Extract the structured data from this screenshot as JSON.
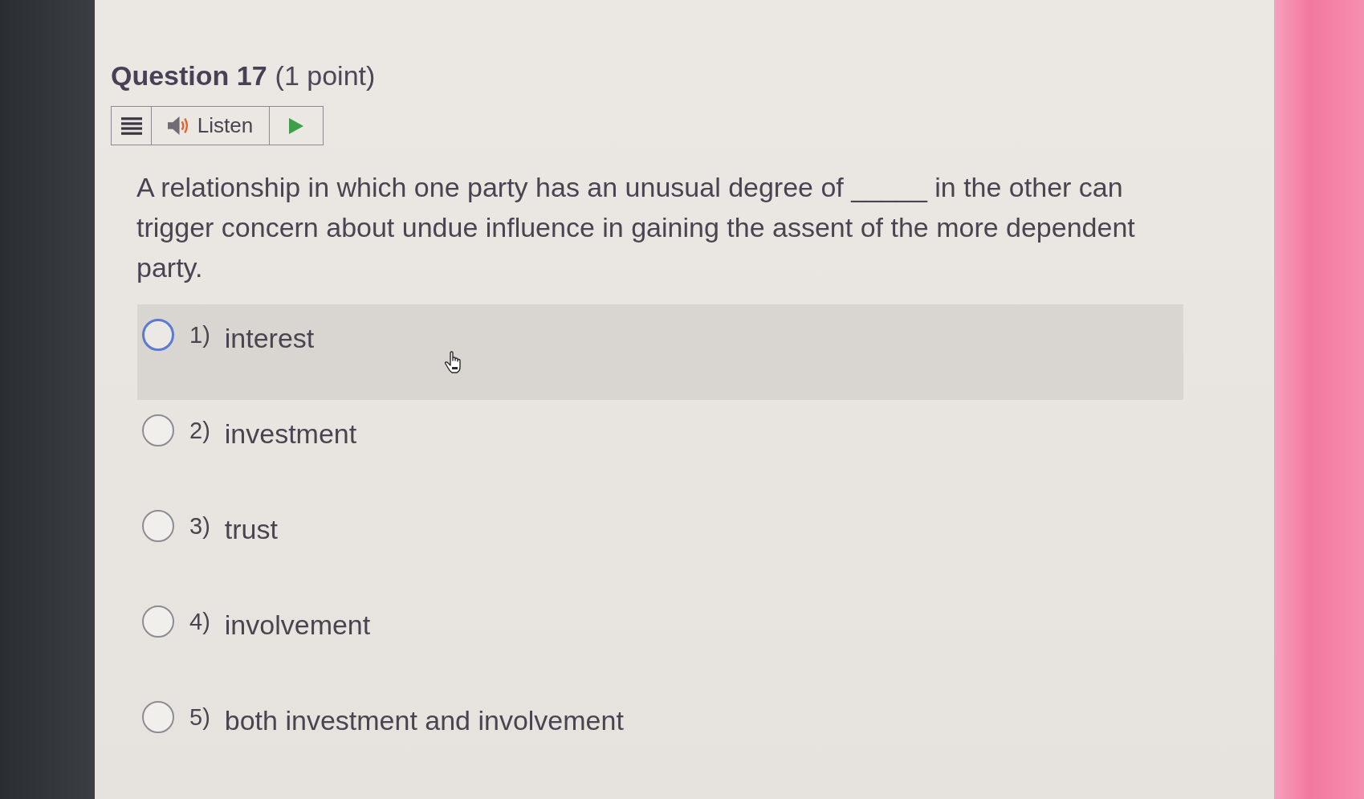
{
  "question": {
    "title": "Question 17",
    "points": "(1 point)"
  },
  "toolbar": {
    "listen_label": "Listen"
  },
  "prompt": "A relationship in which one party has an unusual degree of _____ in the other can trigger concern about undue influence in gaining the assent of the more dependent party.",
  "choices": [
    {
      "number": "1)",
      "label": "interest",
      "selected": false,
      "hovered": true
    },
    {
      "number": "2)",
      "label": "investment",
      "selected": false,
      "hovered": false
    },
    {
      "number": "3)",
      "label": "trust",
      "selected": false,
      "hovered": false
    },
    {
      "number": "4)",
      "label": "involvement",
      "selected": false,
      "hovered": false
    },
    {
      "number": "5)",
      "label": "both investment and involvement",
      "selected": false,
      "hovered": false
    }
  ]
}
